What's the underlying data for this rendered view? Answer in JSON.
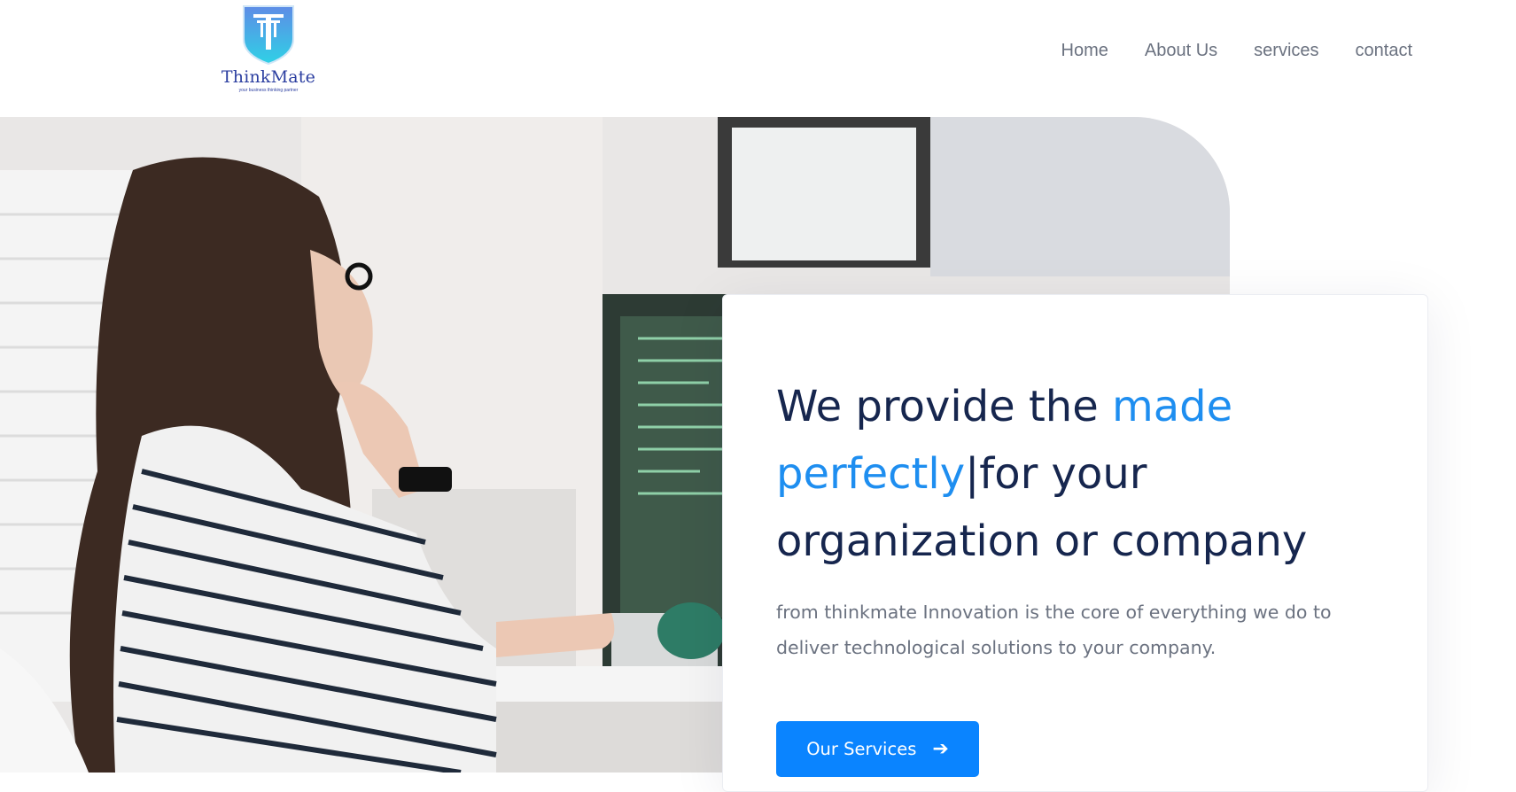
{
  "brand": {
    "name": "ThinkMate",
    "tagline": "your business thinking partner"
  },
  "nav": {
    "items": [
      "Home",
      "About Us",
      "services",
      "contact"
    ]
  },
  "hero": {
    "headline_part1": "We provide the ",
    "headline_accent": "made perfectly",
    "headline_cursor": "|",
    "headline_part2": "for your organization or company",
    "subtext": "from thinkmate Innovation is the core of everything we do to deliver technological solutions to your company.",
    "cta_label": "Our Services",
    "cta_icon": "arrow-right-icon"
  },
  "colors": {
    "accent": "#1e8ef0",
    "button": "#0a84ff",
    "heading": "#16264e",
    "body_text": "#6b7280",
    "logo": "#2b3ea0"
  }
}
